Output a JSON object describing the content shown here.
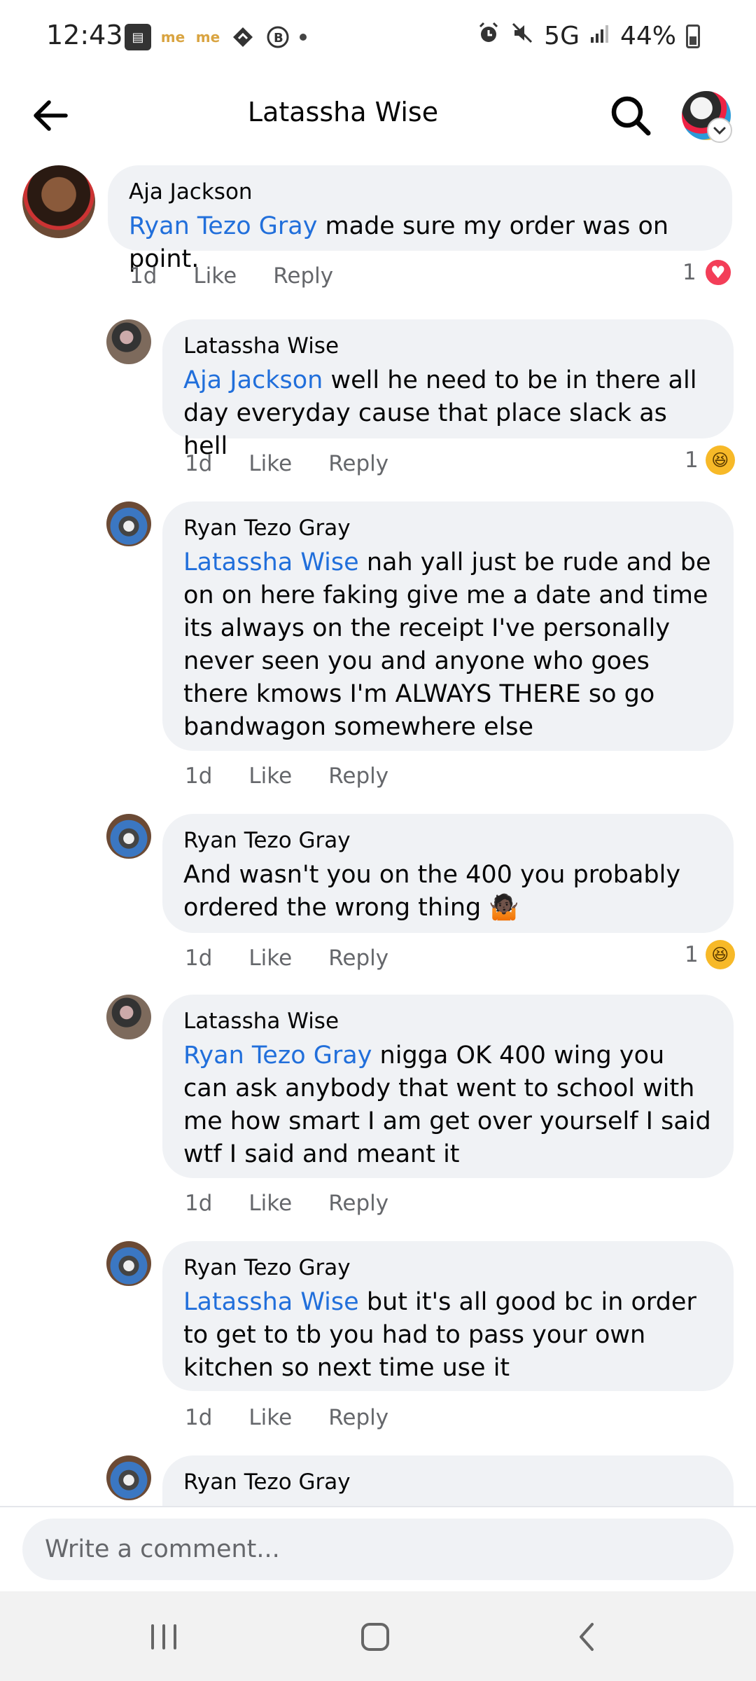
{
  "status_bar": {
    "time": "12:43",
    "network": "5G",
    "battery": "44%"
  },
  "header": {
    "title": "Latassha Wise"
  },
  "comments": [
    {
      "author": "Aja Jackson",
      "mention": "Ryan Tezo Gray",
      "text": " made sure my order was on point.",
      "time": "1d",
      "like": "Like",
      "reply": "Reply",
      "reaction_count": "1",
      "reaction": "heart"
    },
    {
      "author": "Latassha Wise",
      "mention": "Aja Jackson",
      "text": " well he need to be in there all day everyday cause that place slack as hell",
      "time": "1d",
      "like": "Like",
      "reply": "Reply",
      "reaction_count": "1",
      "reaction": "haha"
    },
    {
      "author": "Ryan Tezo Gray",
      "mention": "Latassha Wise",
      "text": " nah yall just be rude and be on on here faking give me a date and time its always on the receipt I've personally never seen you and anyone who goes there kmows I'm ALWAYS THERE so go bandwagon somewhere  else",
      "time": "1d",
      "like": "Like",
      "reply": "Reply"
    },
    {
      "author": "Ryan Tezo Gray",
      "mention": "",
      "text": "And wasn't you on the 400 you probably ordered the wrong thing 🤷🏿",
      "time": "1d",
      "like": "Like",
      "reply": "Reply",
      "reaction_count": "1",
      "reaction": "haha"
    },
    {
      "author": "Latassha Wise",
      "mention": "Ryan Tezo Gray",
      "text": " nigga OK 400 wing you can ask anybody that went to school with me how smart I am get over yourself I said wtf I said and meant it",
      "time": "1d",
      "like": "Like",
      "reply": "Reply"
    },
    {
      "author": "Ryan Tezo Gray",
      "mention": "Latassha Wise",
      "text": " but it's all good bc in order to get to tb you had to pass your own kitchen so next time use it",
      "time": "1d",
      "like": "Like",
      "reply": "Reply"
    },
    {
      "author": "Ryan Tezo Gray"
    }
  ],
  "composer": {
    "placeholder": "Write a comment..."
  },
  "icons": {
    "back": "arrow-left-icon",
    "search": "search-icon",
    "recents": "recent-apps-icon",
    "home": "home-icon",
    "nav_back": "nav-back-icon"
  }
}
